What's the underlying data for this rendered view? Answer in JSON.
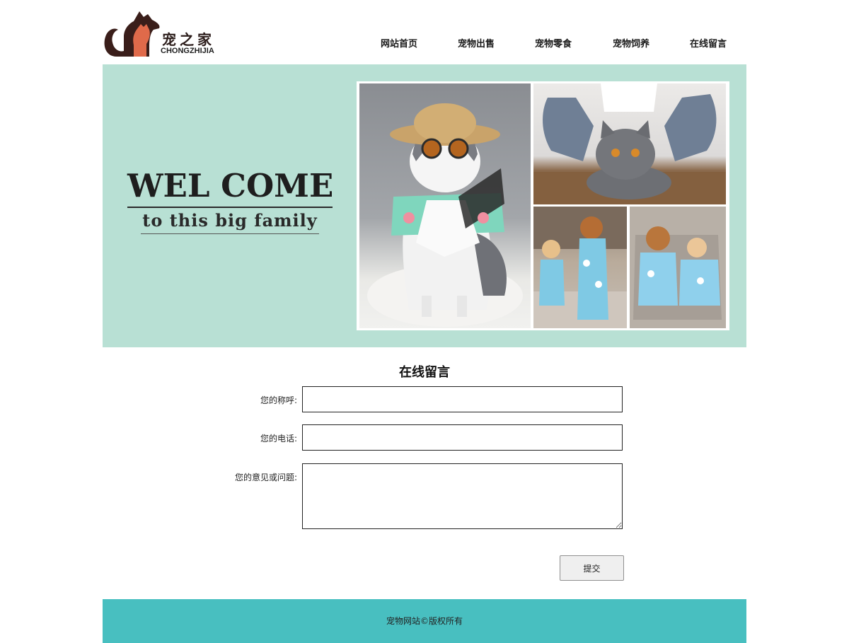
{
  "logo": {
    "name_cn": "宠之家",
    "name_en": "CHONGZHIJIA"
  },
  "nav": {
    "items": [
      {
        "label": "网站首页"
      },
      {
        "label": "宠物出售"
      },
      {
        "label": "宠物零食"
      },
      {
        "label": "宠物饲养"
      },
      {
        "label": "在线留言"
      }
    ]
  },
  "banner": {
    "title": "WEL COME",
    "subtitle": "to this big family",
    "background": "#b8e0d4"
  },
  "form": {
    "title": "在线留言",
    "name_label": "您的称呼:",
    "name_value": "",
    "phone_label": "您的电话:",
    "phone_value": "",
    "message_label": "您的意见或问题:",
    "message_value": "",
    "submit_label": "提交"
  },
  "footer": {
    "text": "宠物网站©版权所有",
    "background": "#48bfc0"
  },
  "colors": {
    "accent_teal": "#48bfc0",
    "banner_mint": "#b8e0d4"
  }
}
